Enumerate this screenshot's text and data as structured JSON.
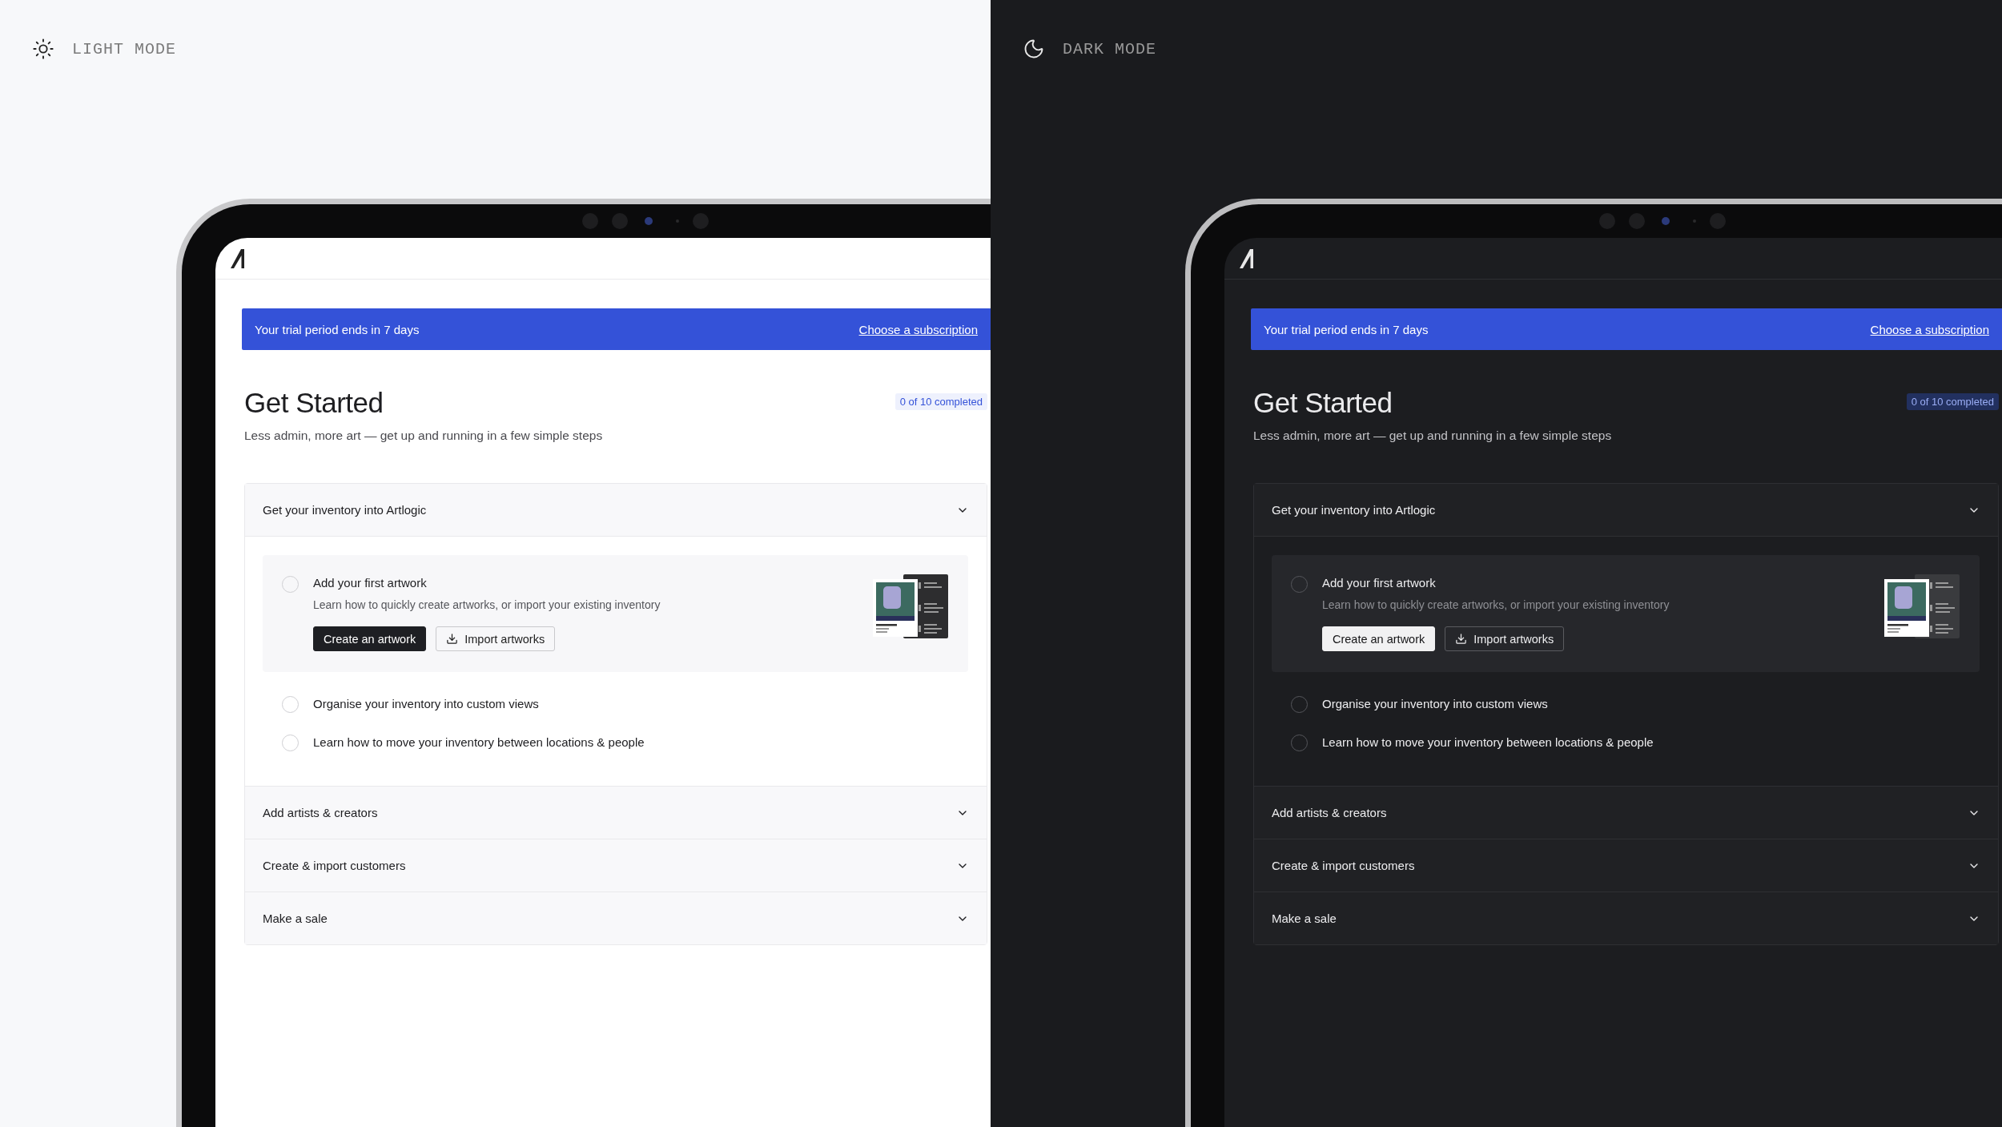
{
  "panels": [
    {
      "kind": "light",
      "label": "LIGHT MODE",
      "banner": {
        "text": "Your trial period ends in 7 days",
        "link": "Choose a subscription"
      },
      "title": "Get Started",
      "subtitle": "Less admin, more art — get up and running in a few simple steps",
      "progress": "0 of 10 completed",
      "sections": [
        {
          "title": "Get your inventory into Artlogic",
          "expanded": true,
          "tasks": [
            {
              "title": "Add your first artwork",
              "description": "Learn how to quickly create artworks, or import your existing inventory",
              "expanded": true,
              "checked": false,
              "buttons": [
                {
                  "label": "Create an artwork",
                  "kind": "primary"
                },
                {
                  "label": "Import artworks",
                  "kind": "import"
                }
              ]
            },
            {
              "title": "Organise your inventory into custom views",
              "expanded": false,
              "checked": false
            },
            {
              "title": "Learn how to move your inventory between locations & people",
              "expanded": false,
              "checked": false
            }
          ]
        },
        {
          "title": "Add artists & creators",
          "expanded": false
        },
        {
          "title": "Create & import customers",
          "expanded": false
        },
        {
          "title": "Make a sale",
          "expanded": false
        }
      ]
    },
    {
      "kind": "dark",
      "label": "DARK MODE",
      "banner": {
        "text": "Your trial period ends in 7 days",
        "link": "Choose a subscription"
      },
      "title": "Get Started",
      "subtitle": "Less admin, more art — get up and running in a few simple steps",
      "progress": "0 of 10 completed",
      "sections": [
        {
          "title": "Get your inventory into Artlogic",
          "expanded": true,
          "tasks": [
            {
              "title": "Add your first artwork",
              "description": "Learn how to quickly create artworks, or import your existing inventory",
              "expanded": true,
              "checked": false,
              "buttons": [
                {
                  "label": "Create an artwork",
                  "kind": "primary"
                },
                {
                  "label": "Import artworks",
                  "kind": "import"
                }
              ]
            },
            {
              "title": "Organise your inventory into custom views",
              "expanded": false,
              "checked": false
            },
            {
              "title": "Learn how to move your inventory between locations & people",
              "expanded": false,
              "checked": false
            }
          ]
        },
        {
          "title": "Add artists & creators",
          "expanded": false
        },
        {
          "title": "Create & import customers",
          "expanded": false
        },
        {
          "title": "Make a sale",
          "expanded": false
        }
      ]
    }
  ]
}
